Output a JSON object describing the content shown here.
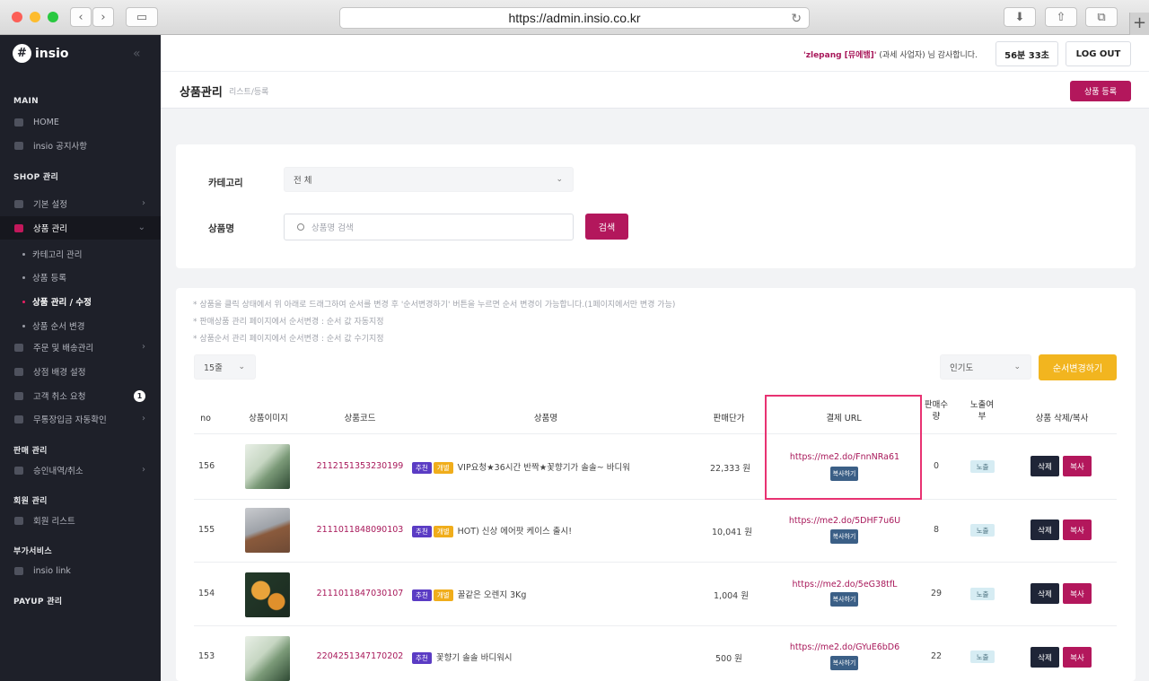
{
  "browser": {
    "url": "https://admin.insio.co.kr"
  },
  "sidebar": {
    "logo": "insio",
    "sections": {
      "main": "MAIN",
      "shop": "SHOP 관리",
      "sales": "판매 관리",
      "member": "회원 관리",
      "addon": "부가서비스",
      "payup": "PAYUP 관리"
    },
    "items": {
      "home": "HOME",
      "notice": "insio 공지사항",
      "basic": "기본 설정",
      "product": "상품 관리",
      "order": "주문 및 배송관리",
      "store_bg": "상점 배경 설정",
      "cancel": "고객 취소 요청",
      "cancel_badge": "1",
      "deposit": "무통장입금 자동확인",
      "approval": "승인내역/취소",
      "member_list": "회원 리스트",
      "link": "insio link"
    },
    "sub_items": {
      "category": "카테고리 관리",
      "register": "상품 등록",
      "edit": "상품 관리 / 수정",
      "order": "상품 순서 변경"
    }
  },
  "header": {
    "user": "'zlepang [뮤에뱀]'",
    "greeting": "(과세 사업자) 님 감사합니다.",
    "timer": "56분 33초",
    "logout": "LOG OUT"
  },
  "page": {
    "title": "상품관리",
    "breadcrumb": "리스트/등록",
    "register_button": "상품 등록"
  },
  "filter": {
    "category_label": "카테고리",
    "category_value": "전 체",
    "name_label": "상품명",
    "search_placeholder": "상품명 검색",
    "search_button": "검색"
  },
  "notes": [
    "* 상품을 클릭 상태에서 위 아래로 드래그하여 순서를 변경 후 '순서변경하기' 버튼을 누르면 순서 변경이 가능합니다.(1페이지에서만 변경 가능)",
    "* 판매상품 관리 페이지에서 순서변경 : 순서 값 자동지정",
    "* 상품순서 관리 페이지에서 순서변경 : 순서 값 수기지정"
  ],
  "controls": {
    "page_size": "15줄",
    "sort": "인기도",
    "reorder_button": "순서변경하기"
  },
  "table": {
    "headers": {
      "no": "no",
      "image": "상품이미지",
      "code": "상품코드",
      "name": "상품명",
      "price": "판매단가",
      "url": "결제 URL",
      "sold": "판매수량",
      "exposure": "노출여부",
      "actions": "상품 삭제/복사"
    },
    "copy_url_label": "복사하기",
    "delete_label": "삭제",
    "copy_label": "복사",
    "rows": [
      {
        "no": "156",
        "code": "211215135323019­9",
        "tags": [
          "추천",
          "개별"
        ],
        "name": "VIP요청★36시간 반짝★꽃향기가 솔솔~ 바디워",
        "price": "22,333 원",
        "url": "https://me2.do/FnnNRa61",
        "sold": "0",
        "exposure": "노출"
      },
      {
        "no": "155",
        "code": "211101184809010­3",
        "tags": [
          "추천",
          "개별"
        ],
        "name": "HOT) 신상 에어팟 케이스 출시!",
        "price": "10,041 원",
        "url": "https://me2.do/5DHF7u6U",
        "sold": "8",
        "exposure": "노출"
      },
      {
        "no": "154",
        "code": "211101184703010­7",
        "tags": [
          "추천",
          "개별"
        ],
        "name": "꿀같은 오렌지 3Kg",
        "price": "1,004 원",
        "url": "https://me2.do/5eG38tfL",
        "sold": "29",
        "exposure": "노출"
      },
      {
        "no": "153",
        "code": "220425134717020­2",
        "tags": [
          "추천"
        ],
        "name": "꽃향기 솔솔 바디워시",
        "price": "500 원",
        "url": "https://me2.do/GYuE6bD6",
        "sold": "22",
        "exposure": "노출"
      }
    ]
  },
  "colors": {
    "accent": "#b3175c",
    "sidebar": "#1e2029",
    "highlight": "#e83272"
  }
}
